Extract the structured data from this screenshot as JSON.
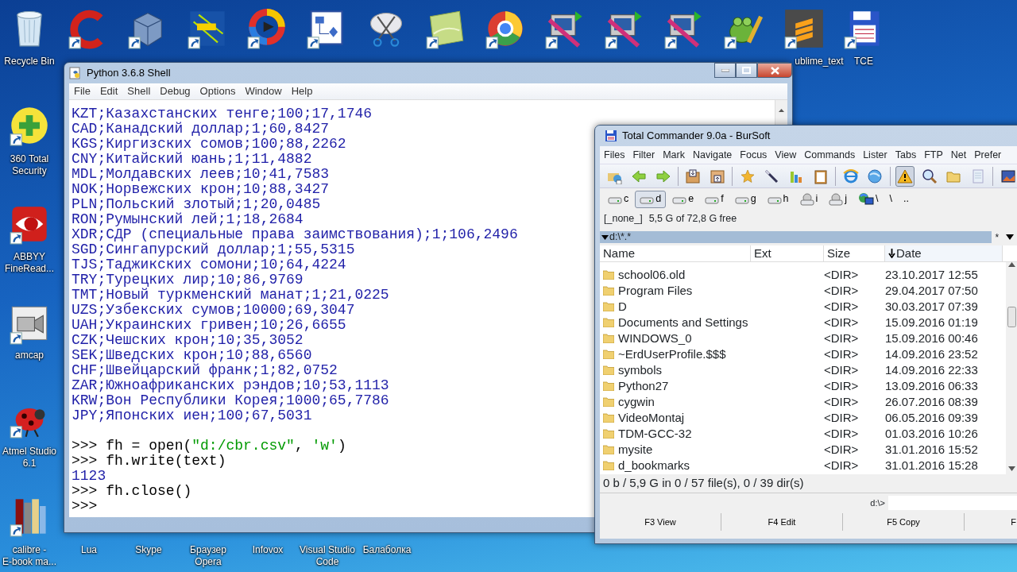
{
  "desktop": {
    "icons": [
      {
        "label": "Recycle Bin"
      },
      {
        "label": "ublime_text"
      },
      {
        "label": "TCE"
      },
      {
        "label": "360 Total\nSecurity"
      },
      {
        "label": "ABBYY\nFineRead..."
      },
      {
        "label": "amcap"
      },
      {
        "label": "Atmel Studio\n6.1"
      },
      {
        "label": "calibre -\nE-book ma..."
      },
      {
        "label": "Lua"
      },
      {
        "label": "Skype"
      },
      {
        "label": "Браузер\nOpera"
      },
      {
        "label": "Infovox"
      },
      {
        "label": "Visual Studio\nCode"
      },
      {
        "label": "Балаболка"
      }
    ]
  },
  "shell": {
    "title": "Python 3.6.8 Shell",
    "menu": [
      "File",
      "Edit",
      "Shell",
      "Debug",
      "Options",
      "Window",
      "Help"
    ],
    "lines": [
      {
        "kind": "output",
        "text": "KZT;Казахстанских тенге;100;17,1746"
      },
      {
        "kind": "output",
        "text": "CAD;Канадский доллар;1;60,8427"
      },
      {
        "kind": "output",
        "text": "KGS;Киргизских сомов;100;88,2262"
      },
      {
        "kind": "output",
        "text": "CNY;Китайский юань;1;11,4882"
      },
      {
        "kind": "output",
        "text": "MDL;Молдавских леев;10;41,7583"
      },
      {
        "kind": "output",
        "text": "NOK;Норвежских крон;10;88,3427"
      },
      {
        "kind": "output",
        "text": "PLN;Польский злотый;1;20,0485"
      },
      {
        "kind": "output",
        "text": "RON;Румынский лей;1;18,2684"
      },
      {
        "kind": "output",
        "text": "XDR;СДР (специальные права заимствования);1;106,2496"
      },
      {
        "kind": "output",
        "text": "SGD;Сингапурский доллар;1;55,5315"
      },
      {
        "kind": "output",
        "text": "TJS;Таджикских сомони;10;64,4224"
      },
      {
        "kind": "output",
        "text": "TRY;Турецких лир;10;86,9769"
      },
      {
        "kind": "output",
        "text": "TMT;Новый туркменский манат;1;21,0225"
      },
      {
        "kind": "output",
        "text": "UZS;Узбекских сумов;10000;69,3047"
      },
      {
        "kind": "output",
        "text": "UAH;Украинских гривен;10;26,6655"
      },
      {
        "kind": "output",
        "text": "CZK;Чешских крон;10;35,3052"
      },
      {
        "kind": "output",
        "text": "SEK;Шведских крон;10;88,6560"
      },
      {
        "kind": "output",
        "text": "CHF;Швейцарский франк;1;82,0752"
      },
      {
        "kind": "output",
        "text": "ZAR;Южноафриканских рэндов;10;53,1113"
      },
      {
        "kind": "output",
        "text": "KRW;Вон Республики Корея;1000;65,7786"
      },
      {
        "kind": "output",
        "text": "JPY;Японских иен;100;67,5031"
      },
      {
        "kind": "blank"
      },
      {
        "kind": "input",
        "prompt": ">>>",
        "parts": [
          {
            "kind": "code",
            "text": "fh = open("
          },
          {
            "kind": "string",
            "text": "\"d:/cbr.csv\""
          },
          {
            "kind": "code",
            "text": ", "
          },
          {
            "kind": "string",
            "text": "'w'"
          },
          {
            "kind": "code",
            "text": ")"
          }
        ]
      },
      {
        "kind": "input",
        "prompt": ">>>",
        "parts": [
          {
            "kind": "code",
            "text": "fh.write(text)"
          }
        ]
      },
      {
        "kind": "output",
        "text": "1123"
      },
      {
        "kind": "input",
        "prompt": ">>>",
        "parts": [
          {
            "kind": "code",
            "text": "fh.close()"
          }
        ]
      },
      {
        "kind": "input",
        "prompt": ">>>"
      }
    ]
  },
  "commander": {
    "title": "Total Commander 9.0a - BurSoft",
    "menu": [
      "Files",
      "Filter",
      "Mark",
      "Navigate",
      "Focus",
      "View",
      "Commands",
      "Lister",
      "Tabs",
      "FTP",
      "Net",
      "Prefer"
    ],
    "drives": [
      {
        "kind": "drive",
        "label": "c",
        "selected": false
      },
      {
        "kind": "drive",
        "label": "d",
        "selected": true
      },
      {
        "kind": "drive",
        "label": "e",
        "selected": false
      },
      {
        "kind": "drive",
        "label": "f",
        "selected": false
      },
      {
        "kind": "drive",
        "label": "g",
        "selected": false
      },
      {
        "kind": "drive",
        "label": "h",
        "selected": false
      },
      {
        "kind": "cdrom",
        "label": "i",
        "selected": false
      },
      {
        "kind": "cdrom",
        "label": "j",
        "selected": false
      },
      {
        "kind": "network",
        "label": "\\",
        "selected": false
      },
      {
        "kind": "plain",
        "label": "\\",
        "selected": false
      },
      {
        "kind": "plain",
        "label": "..",
        "selected": false
      }
    ],
    "volume": "[_none_]",
    "free_space": "5,5 G of 72,8 G free",
    "path": "d:\\*.*",
    "path_star": "*",
    "columns": [
      {
        "label": "Name",
        "sorted": false
      },
      {
        "label": "Ext",
        "sorted": false
      },
      {
        "label": "Size",
        "sorted": false
      },
      {
        "label": "Date",
        "sorted": true
      }
    ],
    "rows": [
      {
        "name": "school06.old",
        "size": "<DIR>",
        "date": "23.10.2017 12:55"
      },
      {
        "name": "Program Files",
        "size": "<DIR>",
        "date": "29.04.2017 07:50"
      },
      {
        "name": "D",
        "size": "<DIR>",
        "date": "30.03.2017 07:39"
      },
      {
        "name": "Documents and Settings",
        "size": "<DIR>",
        "date": "15.09.2016 01:19"
      },
      {
        "name": "WINDOWS_0",
        "size": "<DIR>",
        "date": "15.09.2016 00:46"
      },
      {
        "name": "~ErdUserProfile.$$$",
        "size": "<DIR>",
        "date": "14.09.2016 23:52"
      },
      {
        "name": "symbols",
        "size": "<DIR>",
        "date": "14.09.2016 22:33"
      },
      {
        "name": "Python27",
        "size": "<DIR>",
        "date": "13.09.2016 06:33"
      },
      {
        "name": "cygwin",
        "size": "<DIR>",
        "date": "26.07.2016 08:39"
      },
      {
        "name": "VideoMontaj",
        "size": "<DIR>",
        "date": "06.05.2016 09:39"
      },
      {
        "name": "TDM-GCC-32",
        "size": "<DIR>",
        "date": "01.03.2016 10:26"
      },
      {
        "name": "mysite",
        "size": "<DIR>",
        "date": "31.01.2016 15:52"
      },
      {
        "name": "d_bookmarks",
        "size": "<DIR>",
        "date": "31.01.2016 15:28"
      }
    ],
    "status": "0 b / 5,9 G in 0 / 57 file(s), 0 / 39 dir(s)",
    "command_prompt": "d:\\>",
    "function_keys": [
      "F3 View",
      "F4 Edit",
      "F5 Copy",
      "F"
    ]
  }
}
